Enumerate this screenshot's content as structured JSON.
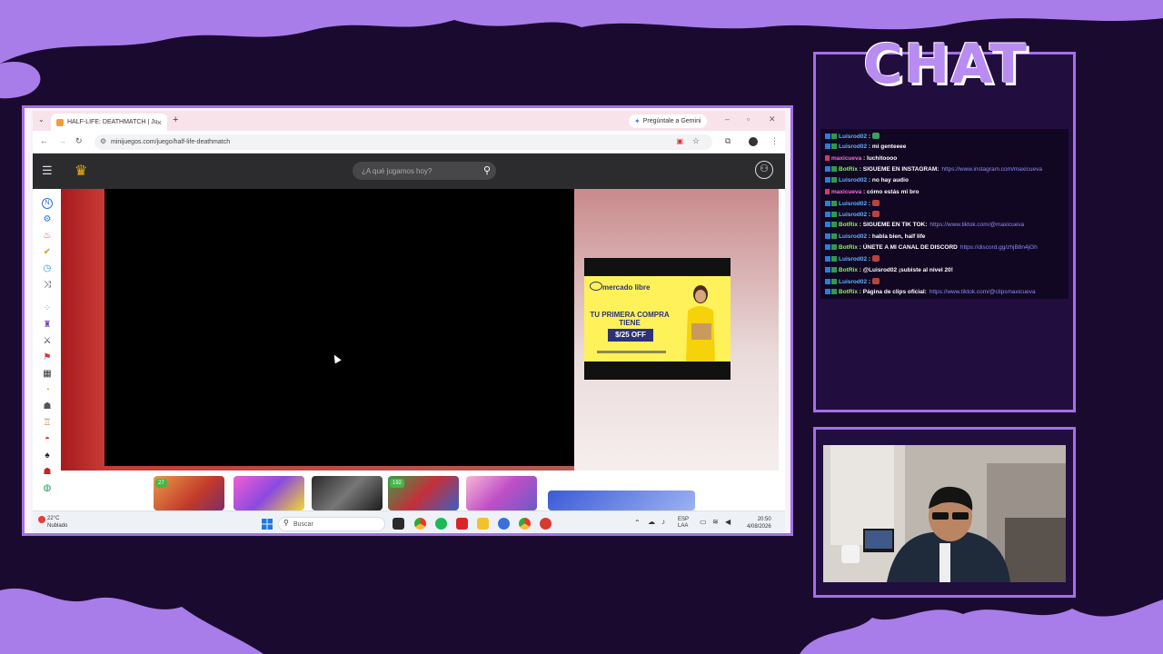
{
  "colors": {
    "accent": "#a46fe8",
    "background": "#1b0a30",
    "chat_title": "#b98cf2"
  },
  "browser": {
    "tab_title": "HALF-LIFE: DEATHMATCH | Juego",
    "gemini_label": "Pregúntale a Gemini",
    "url": "minijuegos.com/juego/half-life-deathmatch"
  },
  "site": {
    "search_placeholder": "¿A qué jugamos hoy?",
    "thumbs": [
      {
        "badge": "27"
      },
      {
        "badge": ""
      },
      {
        "badge": ""
      },
      {
        "badge": "192"
      },
      {
        "badge": ""
      }
    ]
  },
  "ad": {
    "brand": "mercado libre",
    "headline": "TU PRIMERA COMPRA TIENE",
    "offer": "$/25 OFF"
  },
  "taskbar": {
    "weather_temp": "22°C",
    "weather_desc": "Nublado",
    "search": "Buscar",
    "lang": "ESP",
    "region": "LAA",
    "time": "20:50",
    "date": "4/08/2026"
  },
  "chat": {
    "title": "CHAT",
    "messages": [
      {
        "user": "Luisrod02",
        "text": "",
        "type": "luis",
        "emote": "#3aa05c"
      },
      {
        "user": "Luisrod02",
        "text": "mi genteeee",
        "type": "luis"
      },
      {
        "user": "maxicueva",
        "text": "luchitoooo",
        "type": "maxi"
      },
      {
        "user": "BotRix",
        "text": "SIGUEME EN INSTAGRAM:",
        "link": "https://www.instagram.com/maxicueva",
        "type": "bot"
      },
      {
        "user": "Luisrod02",
        "text": "no hay audio",
        "type": "luis"
      },
      {
        "user": "maxicueva",
        "text": "cómo estás mi bro",
        "type": "maxi"
      },
      {
        "user": "Luisrod02",
        "text": "",
        "type": "luis",
        "emote": "#b5453d"
      },
      {
        "user": "Luisrod02",
        "text": "",
        "type": "luis",
        "emote": "#b5453d"
      },
      {
        "user": "BotRix",
        "text": "SIGUEME EN TIK TOK:",
        "link": "https://www.tiktok.com/@maxicueva",
        "type": "bot"
      },
      {
        "user": "Luisrod02",
        "text": "habla bien, half life",
        "type": "luis"
      },
      {
        "user": "BotRix",
        "text": "ÚNETE A MI CANAL DE DISCORD",
        "link": "https://discord.gg/zhjB8n4jGh",
        "type": "bot"
      },
      {
        "user": "Luisrod02",
        "text": "",
        "type": "luis",
        "emote": "#b5453d"
      },
      {
        "user": "BotRix",
        "text": "@Luisrod02 ¡subiste al nivel 20!",
        "type": "bot"
      },
      {
        "user": "Luisrod02",
        "text": "",
        "type": "luis",
        "emote": "#b5453d"
      },
      {
        "user": "BotRix",
        "text": "Página de clips oficial:",
        "link": "https://www.tiktok.com/@clipsmaxicueva",
        "type": "bot"
      }
    ]
  }
}
